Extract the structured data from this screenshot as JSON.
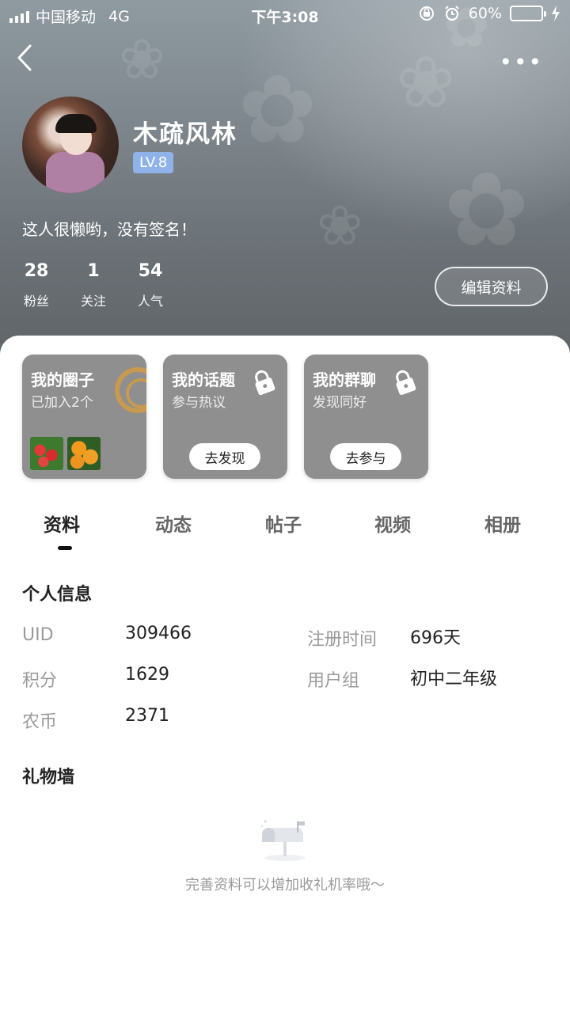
{
  "status_bar": {
    "carrier": "中国移动",
    "network": "4G",
    "time": "下午3:08",
    "battery": "60%",
    "battery_level": 0.6
  },
  "profile": {
    "name": "木疏风林",
    "level": "LV.8",
    "signature": "这人很懒哟，没有签名！",
    "stats": [
      {
        "value": "28",
        "label": "粉丝"
      },
      {
        "value": "1",
        "label": "关注"
      },
      {
        "value": "54",
        "label": "人气"
      }
    ],
    "edit_button": "编辑资料"
  },
  "cards": [
    {
      "title": "我的圈子",
      "subtitle": "已加入2个",
      "locked": false
    },
    {
      "title": "我的话题",
      "subtitle": "参与热议",
      "button": "去发现",
      "locked": true
    },
    {
      "title": "我的群聊",
      "subtitle": "发现同好",
      "button": "去参与",
      "locked": true
    }
  ],
  "tabs": [
    "资料",
    "动态",
    "帖子",
    "视频",
    "相册"
  ],
  "active_tab": "资料",
  "personal_info": {
    "title": "个人信息",
    "uid_label": "UID",
    "uid_value": "309466",
    "register_label": "注册时间",
    "register_value": "696天",
    "points_label": "积分",
    "points_value": "1629",
    "group_label": "用户组",
    "group_value": "初中二年级",
    "coins_label": "农币",
    "coins_value": "2371"
  },
  "gift_wall": {
    "title": "礼物墙",
    "empty_text": "完善资料可以增加收礼机率哦～"
  },
  "colors": {
    "level_badge": "#8fb3e8",
    "battery_fill": "#4cd964",
    "card_bg": "#8f8f8f"
  }
}
